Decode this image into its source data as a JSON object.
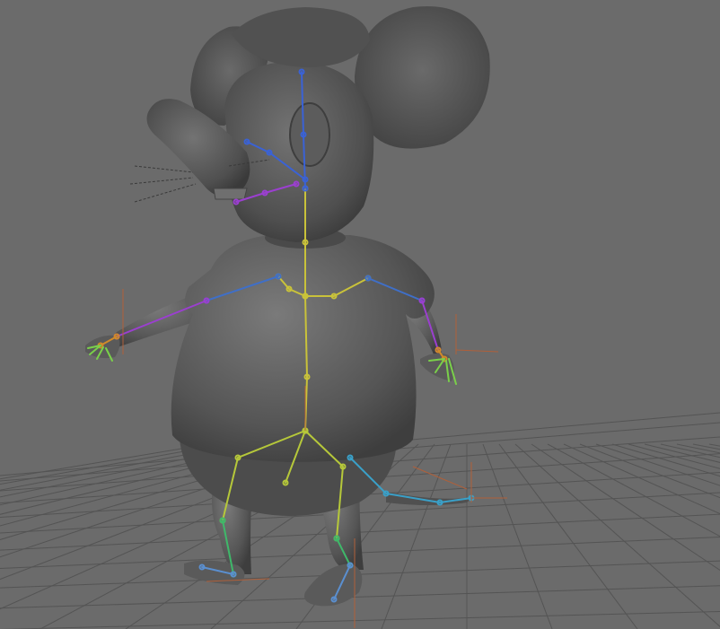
{
  "viewport": {
    "mode": "3d-perspective",
    "background_color": "#6b6b6b",
    "grid_color": "#545454",
    "mesh_color": "#5a5a5a",
    "joint_colors": {
      "spine": "#c9c23a",
      "head": "#3a62d6",
      "arm": "#3f6fc8",
      "forearm": "#9b3fd0",
      "hand": "#d08a2a",
      "fingers": "#7ad04a",
      "leg": "#b6c83a",
      "shin": "#3fb86a",
      "foot": "#5a8fd0",
      "tail": "#3aa0c8"
    }
  },
  "scene": {
    "character": "cartoon-mouse",
    "rig_visible": true,
    "grid_visible": true
  }
}
